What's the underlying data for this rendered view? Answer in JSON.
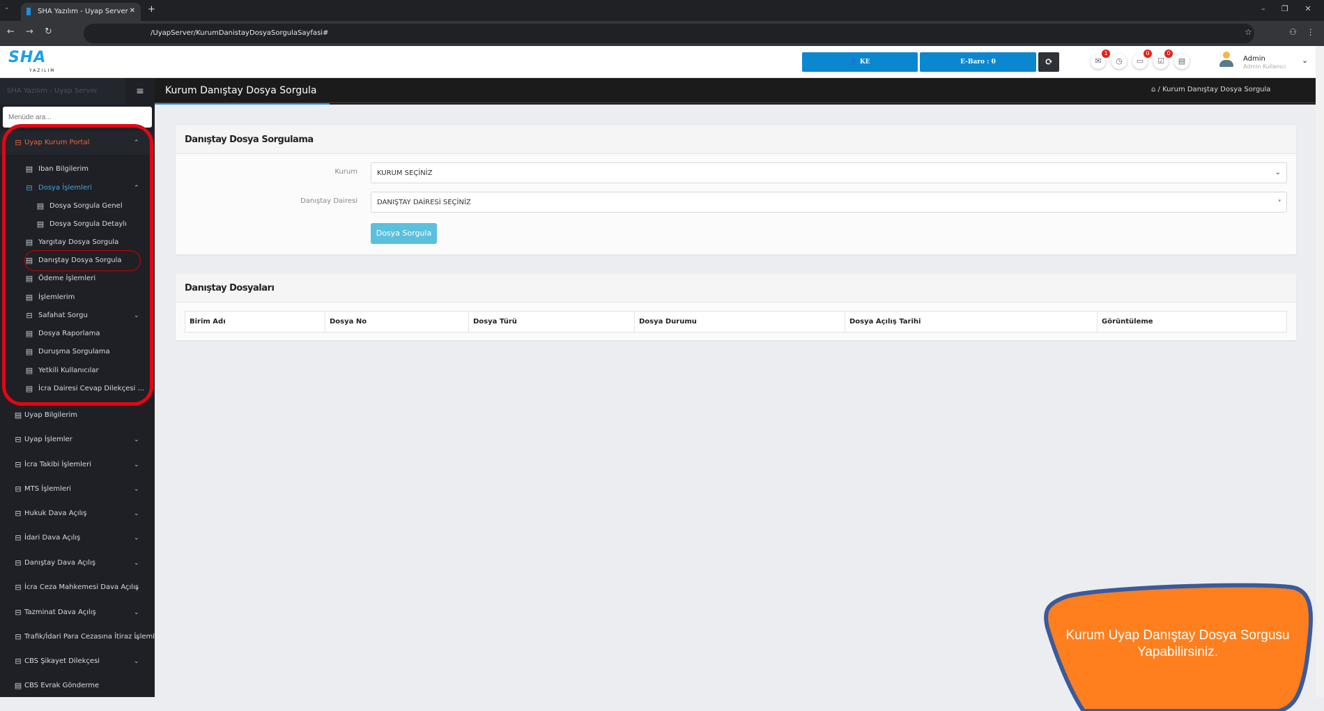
{
  "browser": {
    "tab_title": "SHA Yazılım - Uyap Server",
    "url": "/UyapServer/KurumDanistayDosyaSorgulaSayfasi#"
  },
  "header": {
    "logo": "SHA YAZILIM",
    "user_button": "KE",
    "ebaro": "E-Baro : 0",
    "badges": {
      "mail": "1",
      "notes": "0",
      "tasks": "0"
    },
    "user_name": "Admin",
    "user_role": "Admin Kullanıcı"
  },
  "sidebar": {
    "title": "SHA Yazılım - Uyap Server",
    "search_placeholder": "Menüde ara...",
    "items": [
      {
        "label": "Uyap Kurum Portal",
        "level": 0,
        "icon": "folder-icon",
        "chevron": "up",
        "color": "#f0643c"
      },
      {
        "label": "Iban Bilgilerim",
        "level": 1,
        "icon": "document-icon"
      },
      {
        "label": "Dosya İşlemleri",
        "level": 1,
        "icon": "folder-icon",
        "chevron": "up",
        "color": "#4aa3df"
      },
      {
        "label": "Dosya Sorgula Genel",
        "level": 2,
        "icon": "document-icon"
      },
      {
        "label": "Dosya Sorgula Detaylı",
        "level": 2,
        "icon": "document-icon"
      },
      {
        "label": "Yargıtay Dosya Sorgula",
        "level": 1,
        "icon": "document-icon"
      },
      {
        "label": "Danıştay Dosya Sorgula",
        "level": 1,
        "icon": "document-icon"
      },
      {
        "label": "Ödeme İşlemleri",
        "level": 1,
        "icon": "document-icon"
      },
      {
        "label": "İşlemlerim",
        "level": 1,
        "icon": "document-icon"
      },
      {
        "label": "Safahat Sorgu",
        "level": 1,
        "icon": "folder-icon",
        "chevron": "down"
      },
      {
        "label": "Dosya Raporlama",
        "level": 1,
        "icon": "document-icon"
      },
      {
        "label": "Duruşma Sorgulama",
        "level": 1,
        "icon": "document-icon"
      },
      {
        "label": "Yetkili Kullanıcılar",
        "level": 1,
        "icon": "document-icon"
      },
      {
        "label": "İcra Dairesi Cevap Dilekçesi ...",
        "level": 1,
        "icon": "document-icon"
      },
      {
        "label": "Uyap Bilgilerim",
        "level": 0,
        "icon": "document-icon"
      },
      {
        "label": "Uyap İşlemler",
        "level": 0,
        "icon": "folder-icon",
        "chevron": "down"
      },
      {
        "label": "İcra Takibi İşlemleri",
        "level": 0,
        "icon": "folder-icon",
        "chevron": "down"
      },
      {
        "label": "MTS İşlemleri",
        "level": 0,
        "icon": "folder-icon",
        "chevron": "down"
      },
      {
        "label": "Hukuk Dava Açılış",
        "level": 0,
        "icon": "folder-icon",
        "chevron": "down"
      },
      {
        "label": "İdari Dava Açılış",
        "level": 0,
        "icon": "folder-icon",
        "chevron": "down"
      },
      {
        "label": "Danıştay Dava Açılış",
        "level": 0,
        "icon": "folder-icon",
        "chevron": "down"
      },
      {
        "label": "İcra Ceza Mahkemesi Dava Açılış",
        "level": 0,
        "icon": "folder-icon",
        "chevron": "down"
      },
      {
        "label": "Tazminat Dava Açılış",
        "level": 0,
        "icon": "folder-icon",
        "chevron": "down"
      },
      {
        "label": "Trafik/İdari Para Cezasına İtiraz İşlemleri",
        "level": 0,
        "icon": "folder-icon",
        "chevron": "down"
      },
      {
        "label": "CBS Şikayet Dilekçesi",
        "level": 0,
        "icon": "folder-icon",
        "chevron": "down"
      },
      {
        "label": "CBS Evrak Gönderme",
        "level": 0,
        "icon": "document-icon"
      }
    ]
  },
  "page": {
    "title": "Kurum Danıştay Dosya Sorgula",
    "breadcrumb": "Kurum Danıştay Dosya Sorgula"
  },
  "form": {
    "title": "Danıştay Dosya Sorgulama",
    "kurum_label": "Kurum",
    "kurum_value": "KURUM SEÇİNİZ",
    "daire_label": "Danıştay Dairesi",
    "daire_value": "DANIŞTAY DAİRESİ SEÇİNİZ",
    "submit": "Dosya Sorgula"
  },
  "results": {
    "title": "Danıştay Dosyaları",
    "columns": [
      "Birim Adı",
      "Dosya No",
      "Dosya Türü",
      "Dosya Durumu",
      "Dosya Açılış Tarihi",
      "Görüntüleme"
    ]
  },
  "callout": {
    "text": "Kurum Uyap Danıştay Dosya Sorgusu Yapabilirsiniz.",
    "fill": "#ff7f1e",
    "border": "#3a5a9c"
  }
}
